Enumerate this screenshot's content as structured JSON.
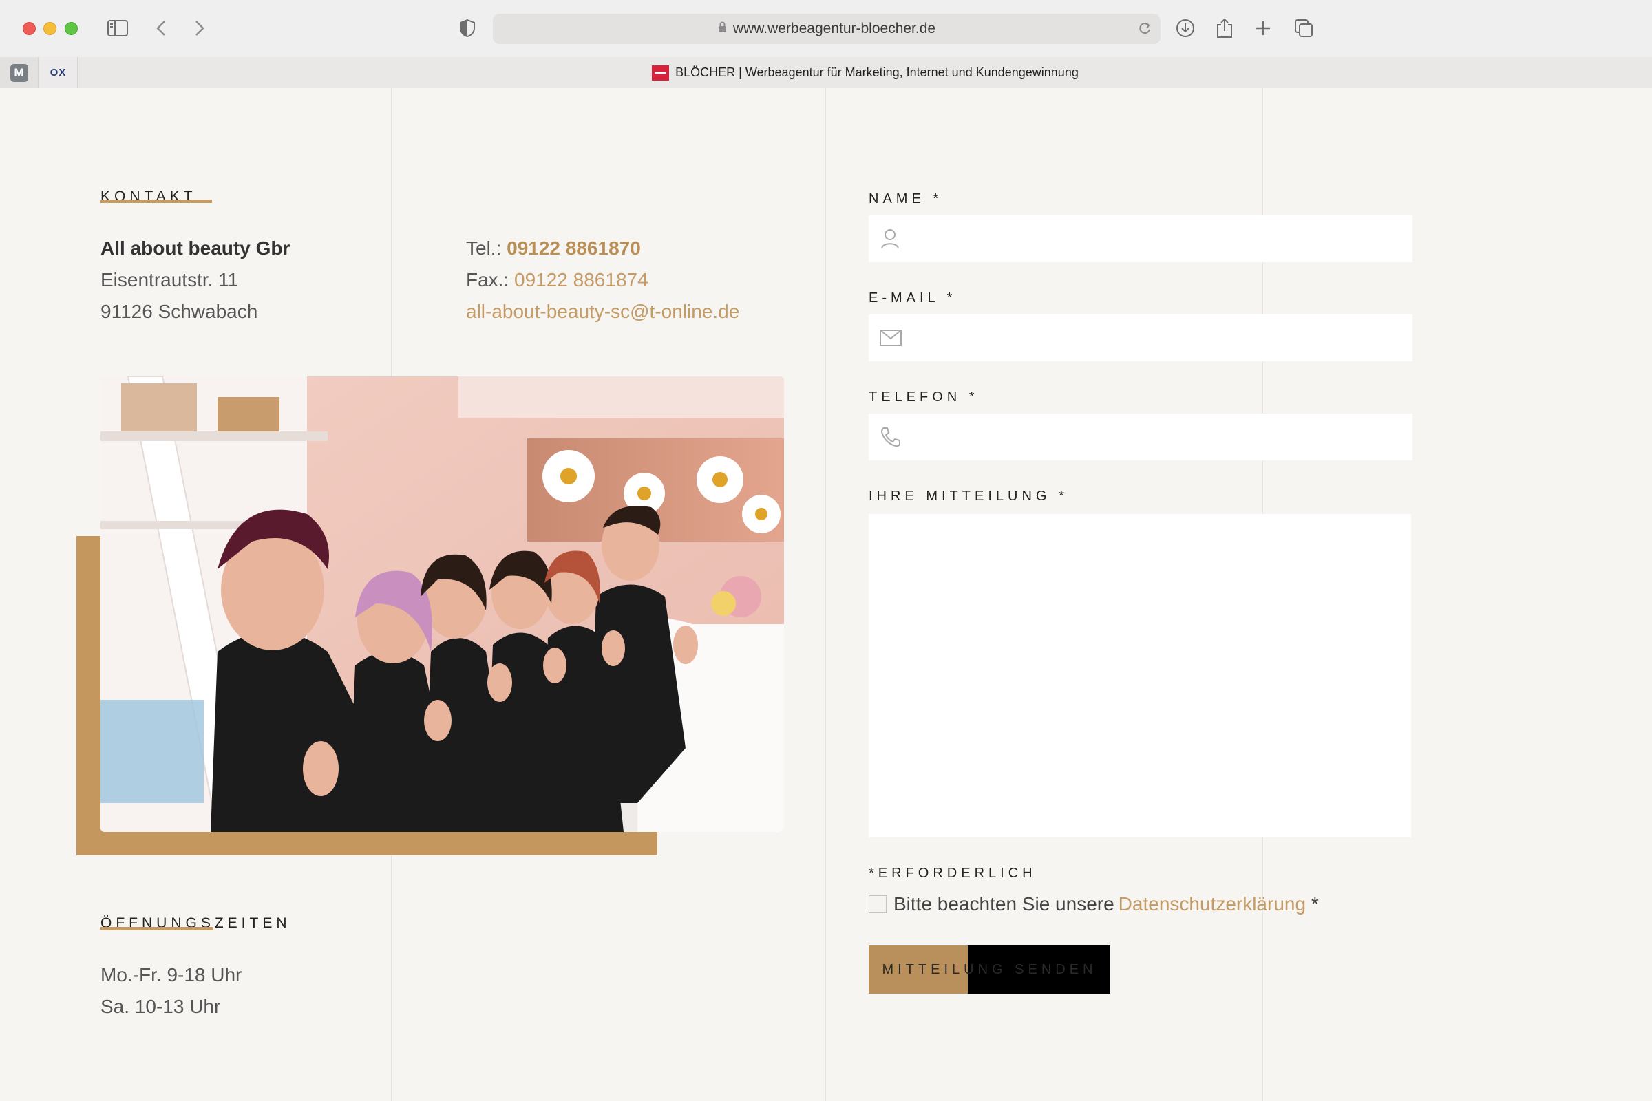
{
  "browser": {
    "url": "www.werbeagentur-bloecher.de",
    "pinned_tabs": [
      "M",
      "OX"
    ],
    "active_tab_title": "BLÖCHER | Werbeagentur für Marketing, Internet und Kundengewinnung"
  },
  "contact": {
    "section_title": "KONTAKT",
    "company": "All about beauty Gbr",
    "street": "Eisentrautstr. 11",
    "city": "91126 Schwabach",
    "tel_label": "Tel.: ",
    "tel_value": "09122 8861870",
    "fax_label": "Fax.: ",
    "fax_value": "09122 8861874",
    "email": "all-about-beauty-sc@t-online.de"
  },
  "hours": {
    "section_title": "ÖFFNUNGSZEITEN",
    "lines": [
      "Mo.-Fr. 9-18 Uhr",
      "Sa. 10-13 Uhr"
    ]
  },
  "form": {
    "name_label": "NAME *",
    "email_label": "E-MAIL *",
    "phone_label": "TELEFON *",
    "message_label": "IHRE MITTEILUNG *",
    "required_note": "*ERFORDERLICH",
    "privacy_text": "Bitte beachten Sie unsere ",
    "privacy_link": "Datenschutzerklärung",
    "privacy_star": " *",
    "submit_label": "MITTEILUNG SENDEN",
    "submit_progress": 0.41
  },
  "colors": {
    "accent": "#c49a65",
    "page_bg": "#f7f5f1"
  }
}
